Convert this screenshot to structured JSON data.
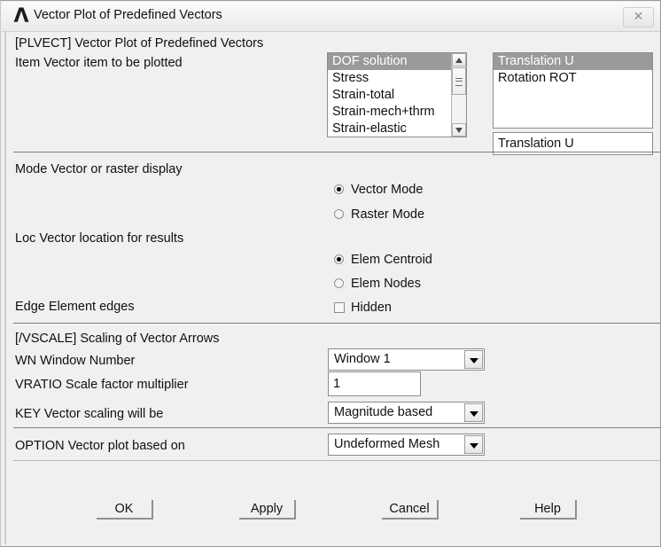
{
  "window": {
    "title": "Vector Plot of Predefined Vectors",
    "logo_icon": "ansys-a-logo",
    "close_icon": "close-icon",
    "close_glyph": "✕"
  },
  "section_item": {
    "command_label": "[PLVECT]  Vector Plot of Predefined Vectors",
    "item_label": "Item  Vector item to be plotted",
    "category_list": {
      "options": [
        "DOF solution",
        "Stress",
        "Strain-total",
        "Strain-mech+thrm",
        "Strain-elastic"
      ],
      "selected": "DOF solution",
      "selected_index": 0
    },
    "component_list": {
      "options": [
        "Translation   U",
        "Rotation     ROT"
      ],
      "selected": "Translation   U",
      "selected_index": 0
    },
    "selected_value": "Translation   U"
  },
  "section_mode": {
    "mode_label": "Mode  Vector or raster display",
    "mode_options": [
      {
        "label": "Vector Mode",
        "selected": true
      },
      {
        "label": "Raster Mode",
        "selected": false
      }
    ],
    "loc_label": "Loc  Vector location for results",
    "loc_options": [
      {
        "label": "Elem Centroid",
        "selected": true
      },
      {
        "label": "Elem Nodes",
        "selected": false
      }
    ],
    "edge_label": "Edge Element edges",
    "hidden_checkbox": {
      "label": "Hidden",
      "checked": false
    }
  },
  "section_vscale": {
    "command_label": "[/VSCALE] Scaling of Vector Arrows",
    "wn_label": "WN  Window Number",
    "wn_value": "Window 1",
    "vratio_label": "VRATIO  Scale factor multiplier",
    "vratio_value": "1",
    "key_label": "KEY     Vector scaling will be",
    "key_value": "Magnitude based"
  },
  "section_option": {
    "option_label": "OPTION  Vector plot based on",
    "option_value": "Undeformed Mesh"
  },
  "buttons": {
    "ok": "OK",
    "apply": "Apply",
    "cancel": "Cancel",
    "help": "Help"
  },
  "colors": {
    "dialog_bg": "#f0f0f0",
    "selection": "#9a9a9a",
    "field_bg": "#ffffff",
    "border": "#8c8c8c",
    "text": "#101010"
  }
}
